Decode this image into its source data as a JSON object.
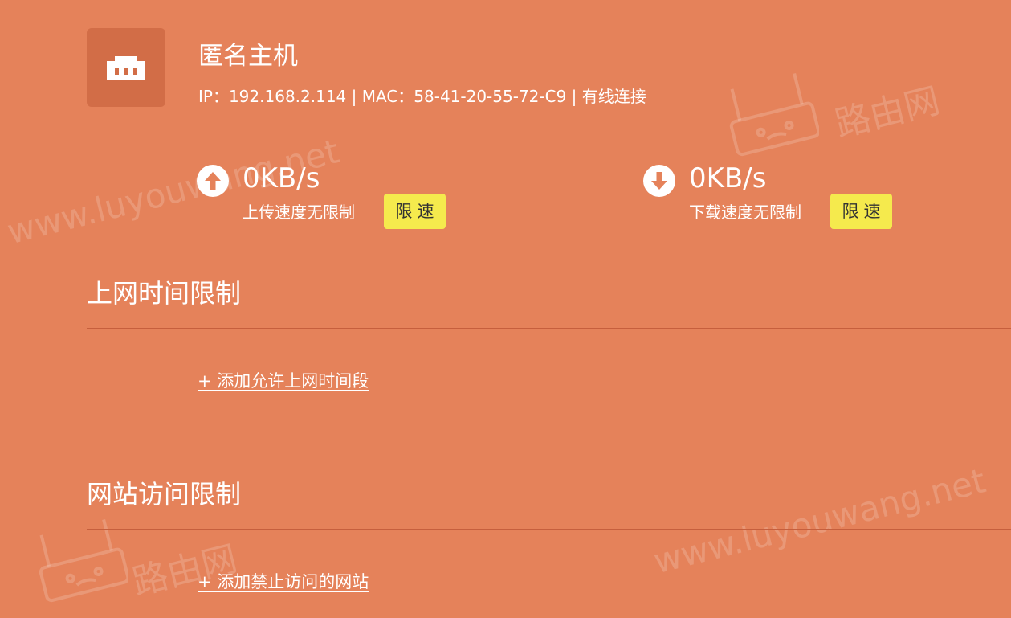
{
  "device": {
    "name": "匿名主机",
    "info": "IP：192.168.2.114 | MAC：58-41-20-55-72-C9 | 有线连接",
    "icon": "ethernet-port-icon"
  },
  "upload": {
    "value": "0KB/s",
    "description": "上传速度无限制",
    "button_label": "限速",
    "icon": "arrow-up-circle-icon"
  },
  "download": {
    "value": "0KB/s",
    "description": "下载速度无限制",
    "button_label": "限速",
    "icon": "arrow-down-circle-icon"
  },
  "sections": {
    "time_limit": {
      "title": "上网时间限制",
      "add_label": "+ 添加允许上网时间段"
    },
    "site_limit": {
      "title": "网站访问限制",
      "add_label": "+ 添加禁止访问的网站"
    }
  },
  "watermarks": {
    "url_text": "www.luyouwang.net",
    "brand_text": "路由网"
  },
  "colors": {
    "background": "#e5825a",
    "icon_box": "#d26d47",
    "limit_button": "#f5ea4d",
    "divider": "#c65f3d"
  }
}
